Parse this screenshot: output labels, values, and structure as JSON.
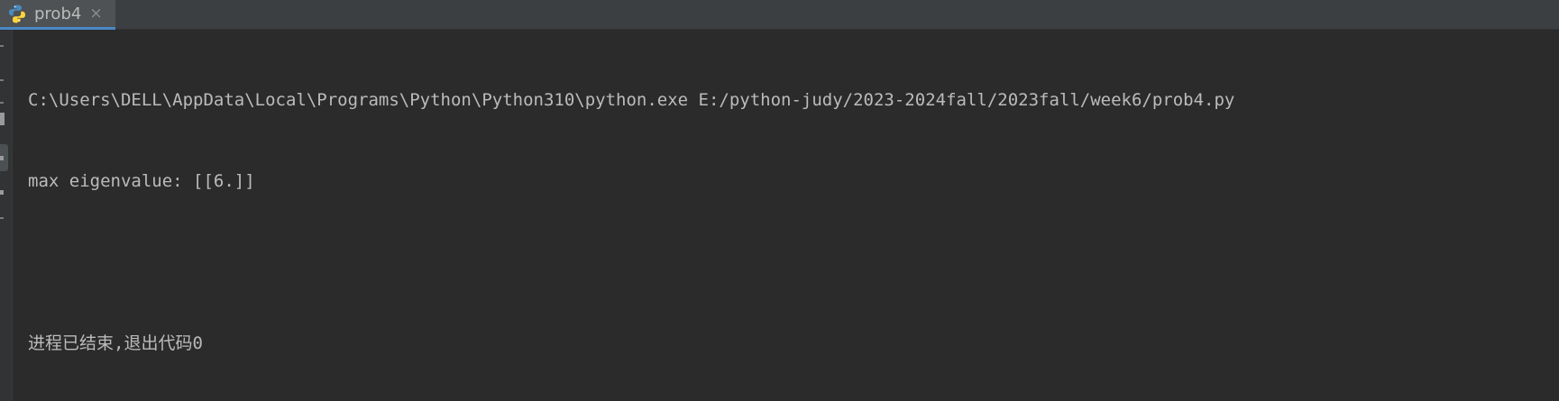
{
  "tab": {
    "label": "prob4",
    "icon": "python-icon",
    "close": "×"
  },
  "console": {
    "command": "C:\\Users\\DELL\\AppData\\Local\\Programs\\Python\\Python310\\python.exe E:/python-judy/2023-2024fall/2023fall/week6/prob4.py",
    "output": "max eigenvalue: [[6.]]",
    "blank": "",
    "exit_message": "进程已结束,退出代码0"
  },
  "colors": {
    "background": "#2b2b2b",
    "text": "#bbbbbb",
    "tab_active_underline": "#4a88c7"
  }
}
